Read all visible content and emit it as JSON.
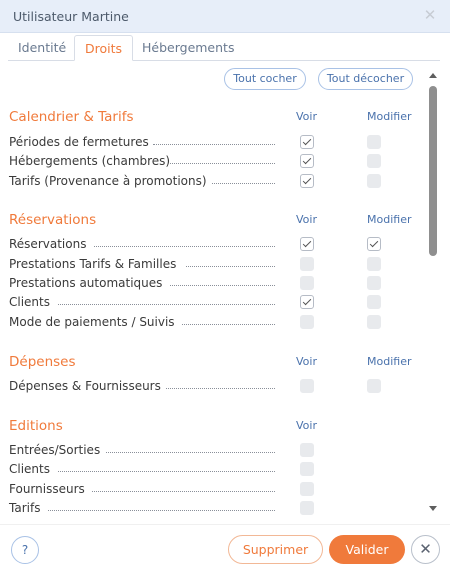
{
  "window": {
    "title": "Utilisateur Martine",
    "close_icon": "✕"
  },
  "tabs": [
    {
      "label": "Identité",
      "active": false
    },
    {
      "label": "Droits",
      "active": true
    },
    {
      "label": "Hébergements",
      "active": false
    }
  ],
  "actions": {
    "check_all": "Tout cocher",
    "uncheck_all": "Tout décocher"
  },
  "sections": [
    {
      "title": "Calendrier & Tarifs",
      "col_view": "Voir",
      "col_edit": "Modifier",
      "rows": [
        {
          "label": "Périodes de fermetures",
          "view": true,
          "edit": false
        },
        {
          "label": "Hébergements (chambres)",
          "view": true,
          "edit": false
        },
        {
          "label": "Tarifs (Provenance à promotions)",
          "view": true,
          "edit": false
        }
      ]
    },
    {
      "title": "Réservations",
      "col_view": "Voir",
      "col_edit": "Modifier",
      "rows": [
        {
          "label": "Réservations",
          "view": true,
          "edit": true
        },
        {
          "label": "Prestations Tarifs & Familles",
          "view": false,
          "edit": false
        },
        {
          "label": "Prestations automatiques",
          "view": false,
          "edit": false
        },
        {
          "label": "Clients",
          "view": true,
          "edit": false
        },
        {
          "label": "Mode de paiements / Suivis",
          "view": false,
          "edit": false
        }
      ]
    },
    {
      "title": "Dépenses",
      "col_view": "Voir",
      "col_edit": "Modifier",
      "rows": [
        {
          "label": "Dépenses & Fournisseurs",
          "view": false,
          "edit": false
        }
      ]
    },
    {
      "title": "Editions",
      "col_view": "Voir",
      "rows": [
        {
          "label": "Entrées/Sorties",
          "view": false
        },
        {
          "label": "Clients",
          "view": false
        },
        {
          "label": "Fournisseurs",
          "view": false
        },
        {
          "label": "Tarifs",
          "view": false
        }
      ]
    }
  ],
  "footer": {
    "help": "?",
    "delete": "Supprimer",
    "validate": "Valider",
    "close": "✕"
  },
  "colors": {
    "accent": "#f07a3b",
    "link": "#4a72ac"
  }
}
